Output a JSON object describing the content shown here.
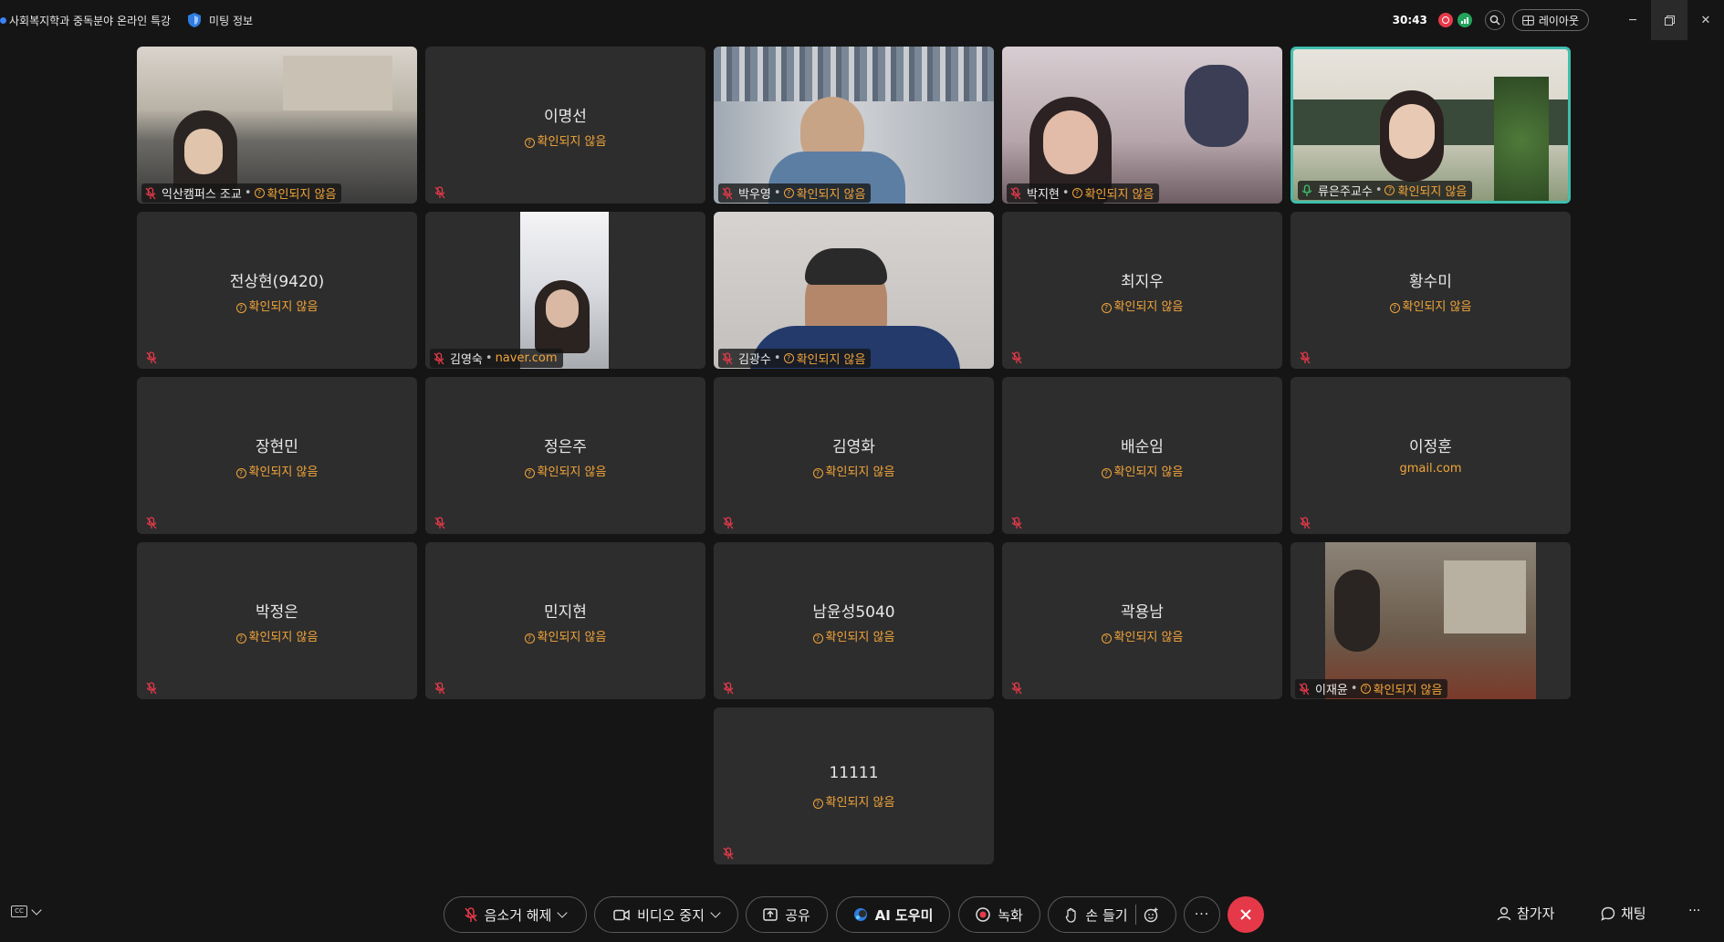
{
  "titlebar": {
    "meeting_title": "사회복지학과 중독분야 온라인 특강",
    "meeting_info": "미팅 정보",
    "timer": "30:43",
    "layout_label": "레이아웃"
  },
  "tiles": [
    {
      "name": "익산캠퍼스 조교",
      "status": "확인되지 않음",
      "video": true
    },
    {
      "name": "이명선",
      "status": "확인되지 않음",
      "video": false
    },
    {
      "name": "박우영",
      "status": "확인되지 않음",
      "video": true
    },
    {
      "name": "박지현",
      "status": "확인되지 않음",
      "video": true
    },
    {
      "name": "류은주교수",
      "status": "확인되지 않음",
      "video": true,
      "active_speaker": true
    },
    {
      "name": "전상현(9420)",
      "status": "확인되지 않음",
      "video": false
    },
    {
      "name": "김영숙",
      "status": "naver.com",
      "video": true
    },
    {
      "name": "김광수",
      "status": "확인되지 않음",
      "video": true
    },
    {
      "name": "최지우",
      "status": "확인되지 않음",
      "video": false
    },
    {
      "name": "황수미",
      "status": "확인되지 않음",
      "video": false
    },
    {
      "name": "장현민",
      "status": "확인되지 않음",
      "video": false
    },
    {
      "name": "정은주",
      "status": "확인되지 않음",
      "video": false
    },
    {
      "name": "김영화",
      "status": "확인되지 않음",
      "video": false
    },
    {
      "name": "배순임",
      "status": "확인되지 않음",
      "video": false
    },
    {
      "name": "이정훈",
      "status": "gmail.com",
      "video": false
    },
    {
      "name": "박정은",
      "status": "확인되지 않음",
      "video": false
    },
    {
      "name": "민지현",
      "status": "확인되지 않음",
      "video": false
    },
    {
      "name": "남윤성5040",
      "status": "확인되지 않음",
      "video": false
    },
    {
      "name": "곽용남",
      "status": "확인되지 않음",
      "video": false
    },
    {
      "name": "이재윤",
      "status": "확인되지 않음",
      "video": true
    },
    {
      "name": "11111",
      "status": "확인되지 않음",
      "video": false
    }
  ],
  "toolbar": {
    "unmute": "음소거 해제",
    "stop_video": "비디오 중지",
    "share": "공유",
    "ai_assistant": "AI 도우미",
    "record": "녹화",
    "raise_hand": "손 들기",
    "participants": "참가자",
    "chat": "채팅"
  },
  "colors": {
    "background": "#151515",
    "tile": "#2d2d2d",
    "unverified": "#f2a53a",
    "active_border": "#3fbfae",
    "end_call": "#e5394a"
  }
}
